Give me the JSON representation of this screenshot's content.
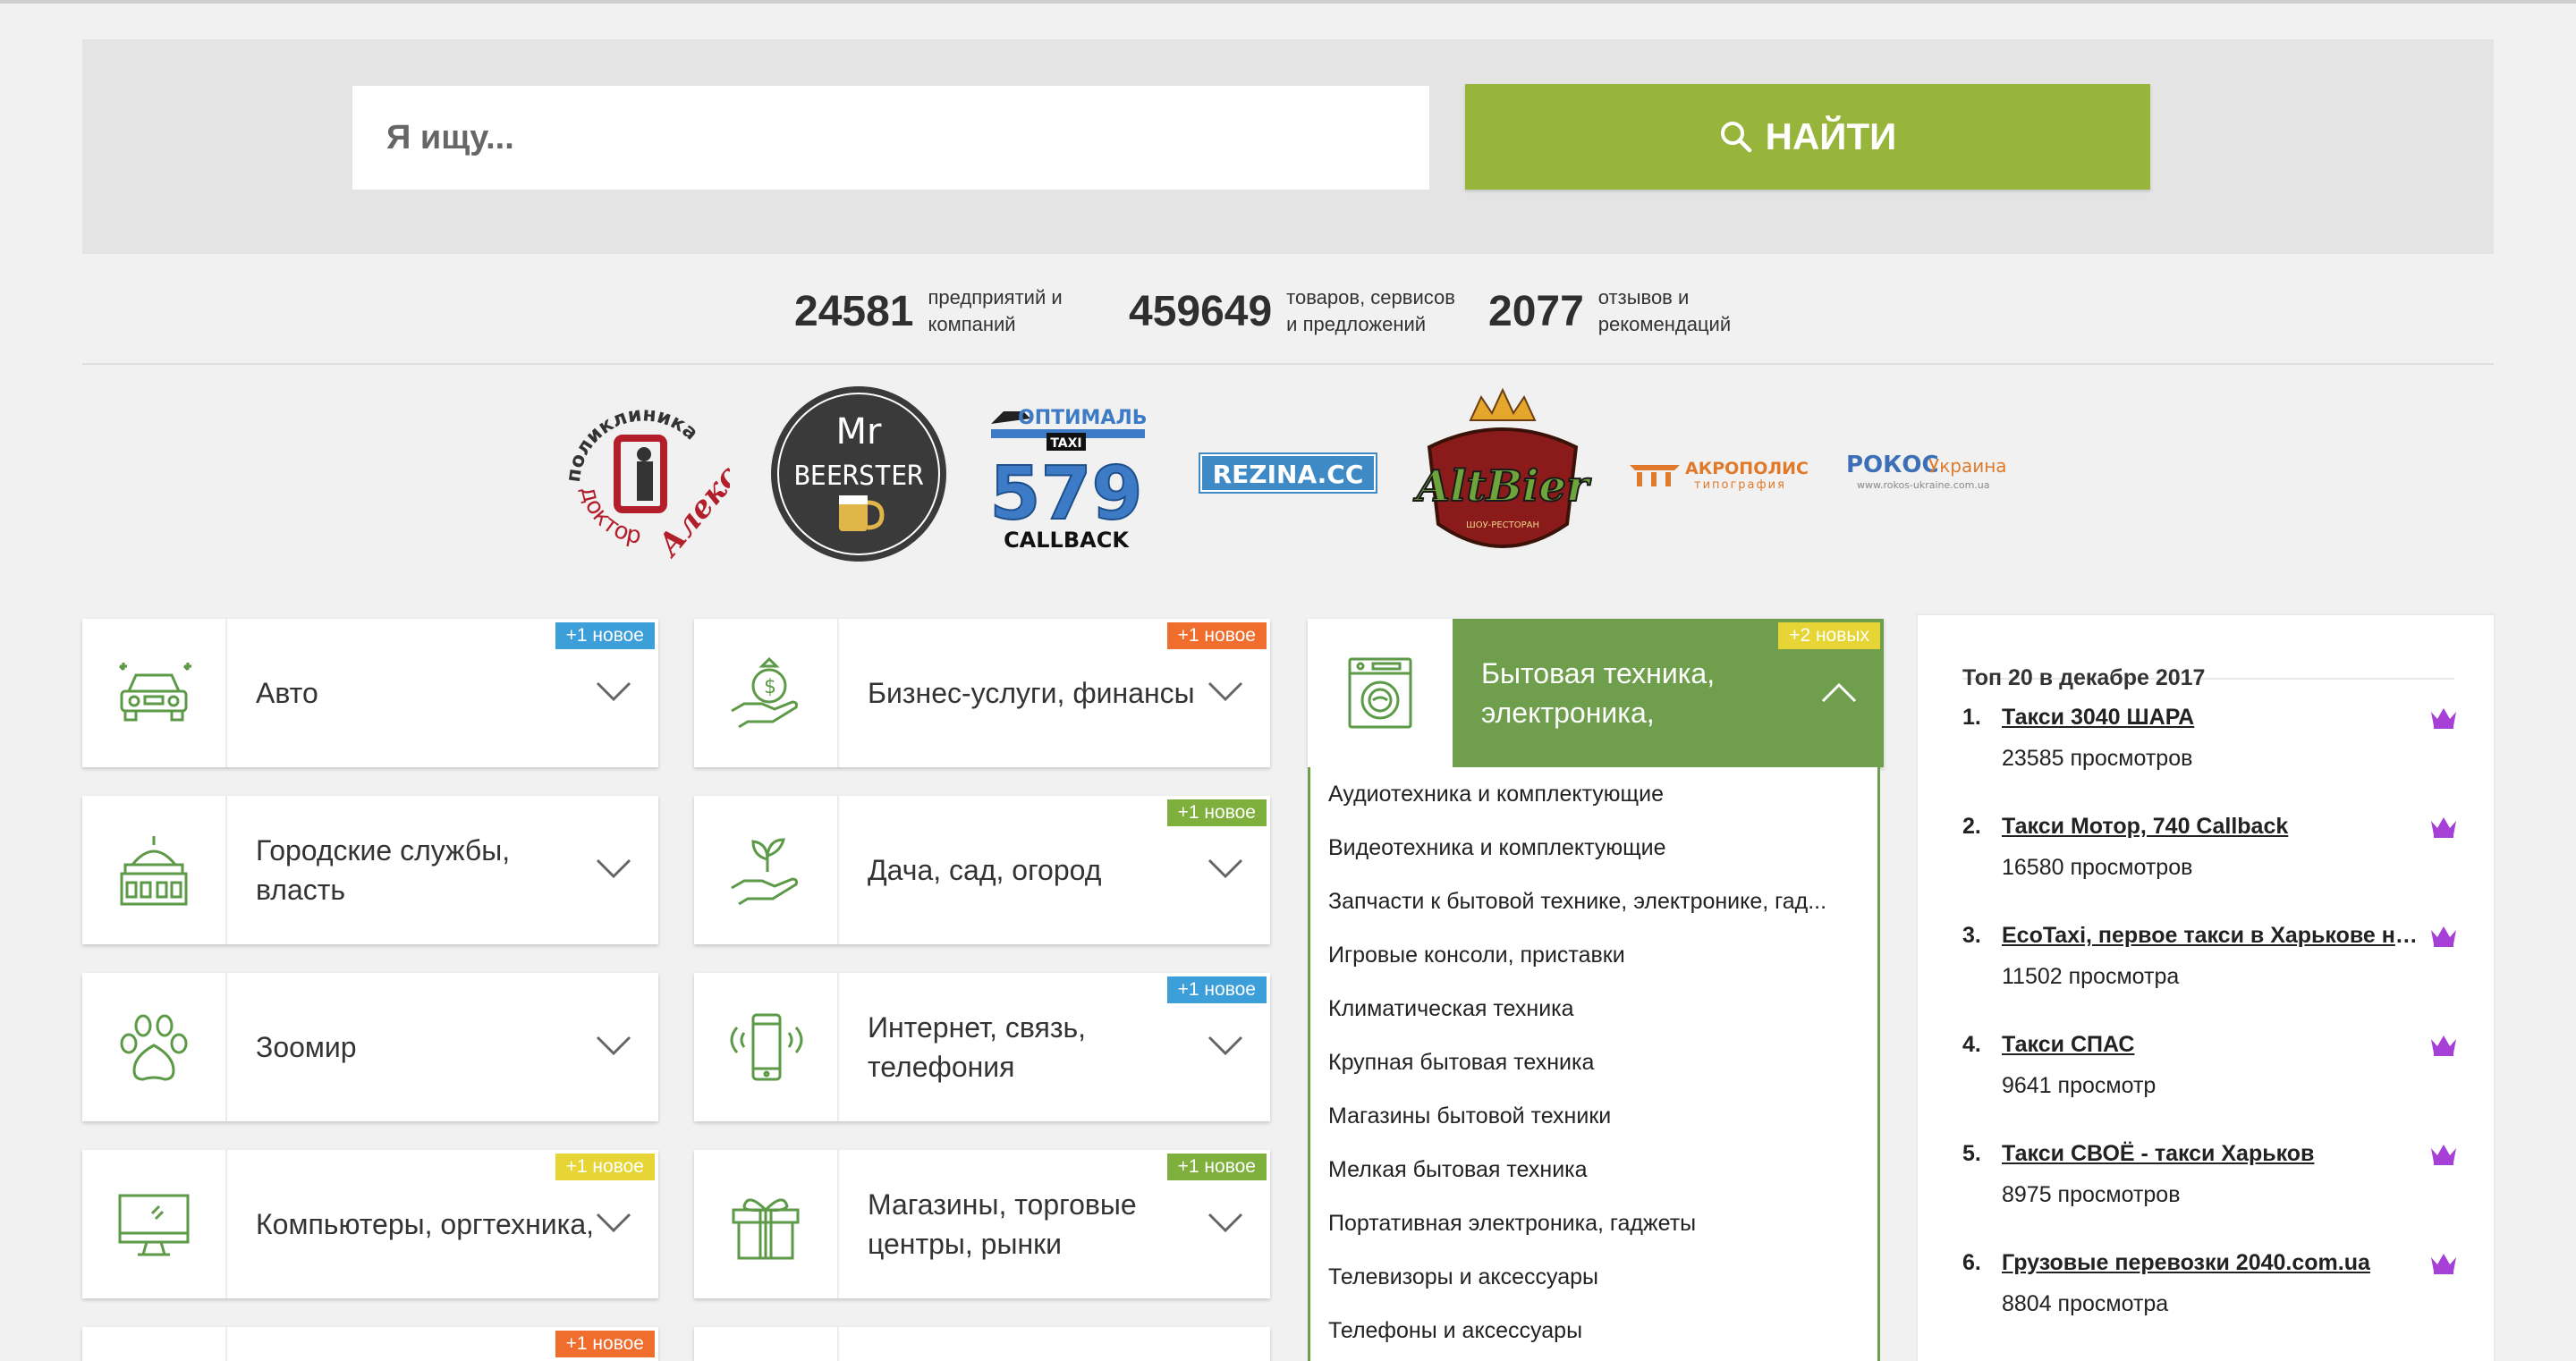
{
  "search": {
    "placeholder": "Я ищу...",
    "button_label": "НАЙТИ"
  },
  "stats": [
    {
      "value": "24581",
      "label": "предприятий и компаний"
    },
    {
      "value": "459649",
      "label": "товаров, сервисов и предложений"
    },
    {
      "value": "2077",
      "label": "отзывов и рекомендаций"
    }
  ],
  "logos": {
    "alex": {
      "top": "поликлиника",
      "bottom": "доктор",
      "name": "Алекс"
    },
    "beerster": {
      "line1": "Mr",
      "line2": "BEERSTER"
    },
    "taxi": {
      "top": "ОПТИМАЛЬНЕ",
      "sub": "TAXI",
      "num": "579",
      "bottom": "CALLBACK"
    },
    "rezina": {
      "text": "REZINA.CC"
    },
    "altbier": {
      "text": "AltBier",
      "sub": "ШОУ-РЕСТОРАН"
    },
    "akropolis": {
      "text": "АКРОПОЛИС",
      "sub": "типография"
    },
    "rokos": {
      "brand": "РОКОС",
      "suffix": "Украина",
      "url": "www.rokos-ukraine.com.ua"
    }
  },
  "categories": [
    {
      "label": "Авто",
      "badge": "+1 новое",
      "badge_color": "#3d9fd9"
    },
    {
      "label": "Бизнес-услуги, финансы",
      "badge": "+1 новое",
      "badge_color": "#ef6e2e"
    },
    {
      "label": "Бытовая техника, электроника,",
      "badge": "+2 новых",
      "badge_color": "#e6d534"
    },
    {
      "label": "Городские службы, власть",
      "badge": "",
      "badge_color": ""
    },
    {
      "label": "Дача, сад, огород",
      "badge": "+1 новое",
      "badge_color": "#7faf3c"
    },
    {
      "label": "Зоомир",
      "badge": "",
      "badge_color": ""
    },
    {
      "label": "Интернет, связь, телефония",
      "badge": "+1 новое",
      "badge_color": "#3d9fd9"
    },
    {
      "label": "Компьютеры, оргтехника,",
      "badge": "+1 новое",
      "badge_color": "#e6d534"
    },
    {
      "label": "Магазины, торговые центры, рынки",
      "badge": "+1 новое",
      "badge_color": "#7faf3c"
    },
    {
      "label": "",
      "badge": "+1 новое",
      "badge_color": "#ef6e2e"
    }
  ],
  "dropdown": [
    "Аудиотехника и комплектующие",
    "Видеотехника и комплектующие",
    "Запчасти к бытовой технике, электронике, гад...",
    "Игровые консоли, приставки",
    "Климатическая техника",
    "Крупная бытовая техника",
    "Магазины бытовой техники",
    "Мелкая бытовая техника",
    "Портативная электроника, гаджеты",
    "Телевизоры и аксессуары",
    "Телефоны и аксессуары"
  ],
  "top": {
    "title": "Топ 20 в декабре 2017",
    "items": [
      {
        "num": "1.",
        "name": "Такси 3040 ШАРА",
        "views": "23585 просмотров"
      },
      {
        "num": "2.",
        "name": "Такси Мотор, 740 Callback",
        "views": "16580 просмотров"
      },
      {
        "num": "3.",
        "name": "EcoTaxi, первое такси в Харькове на...",
        "views": "11502 просмотра"
      },
      {
        "num": "4.",
        "name": "Такси СПАС",
        "views": "9641 просмотр"
      },
      {
        "num": "5.",
        "name": "Такси СВОЁ - такси Харьков",
        "views": "8975 просмотров"
      },
      {
        "num": "6.",
        "name": "Грузовые перевозки 2040.com.ua",
        "views": "8804 просмотра"
      }
    ]
  },
  "colors": {
    "accent_green": "#97b53b",
    "active_green": "#6f9e4c",
    "icon_green": "#5c9a47",
    "crown_purple": "#a640d6"
  }
}
